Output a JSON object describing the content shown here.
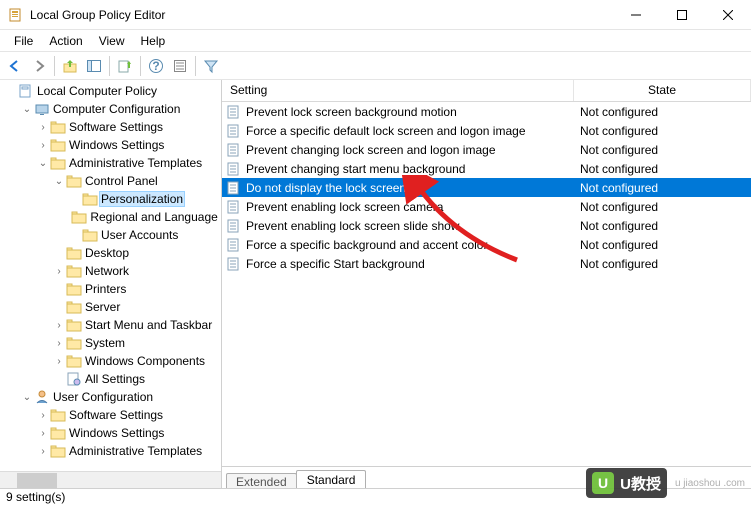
{
  "window": {
    "title": "Local Group Policy Editor"
  },
  "menu": [
    "File",
    "Action",
    "View",
    "Help"
  ],
  "tree": {
    "root": "Local Computer Policy",
    "computer_config": "Computer Configuration",
    "software_settings": "Software Settings",
    "windows_settings": "Windows Settings",
    "admin_templates": "Administrative Templates",
    "control_panel": "Control Panel",
    "personalization": "Personalization",
    "regional_language": "Regional and Language",
    "user_accounts": "User Accounts",
    "desktop": "Desktop",
    "network": "Network",
    "printers": "Printers",
    "server": "Server",
    "start_menu": "Start Menu and Taskbar",
    "system": "System",
    "windows_components": "Windows Components",
    "all_settings": "All Settings",
    "user_config": "User Configuration",
    "u_software_settings": "Software Settings",
    "u_windows_settings": "Windows Settings",
    "u_admin_templates": "Administrative Templates"
  },
  "list": {
    "header_setting": "Setting",
    "header_state": "State",
    "rows": [
      {
        "name": "Prevent lock screen background motion",
        "state": "Not configured",
        "selected": false
      },
      {
        "name": "Force a specific default lock screen and logon image",
        "state": "Not configured",
        "selected": false
      },
      {
        "name": "Prevent changing lock screen and logon image",
        "state": "Not configured",
        "selected": false
      },
      {
        "name": "Prevent changing start menu background",
        "state": "Not configured",
        "selected": false
      },
      {
        "name": "Do not display the lock screen",
        "state": "Not configured",
        "selected": true
      },
      {
        "name": "Prevent enabling lock screen camera",
        "state": "Not configured",
        "selected": false
      },
      {
        "name": "Prevent enabling lock screen slide show",
        "state": "Not configured",
        "selected": false
      },
      {
        "name": "Force a specific background and accent color",
        "state": "Not configured",
        "selected": false
      },
      {
        "name": "Force a specific Start background",
        "state": "Not configured",
        "selected": false
      }
    ]
  },
  "tabs": {
    "extended": "Extended",
    "standard": "Standard"
  },
  "status": "9 setting(s)",
  "watermark": {
    "brand": "U教授",
    "url": "u jiaoshou .com"
  }
}
